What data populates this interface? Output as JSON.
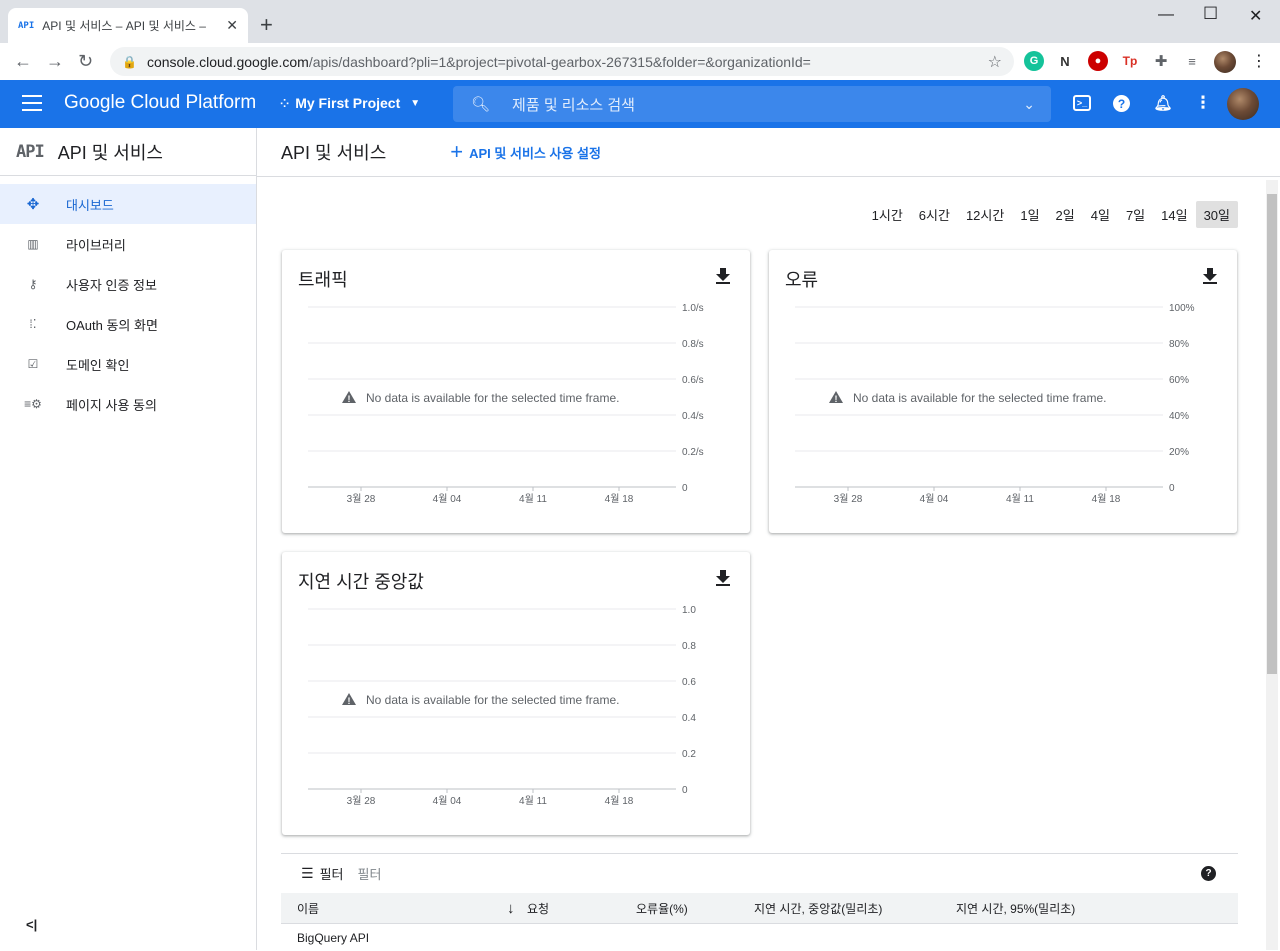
{
  "browser": {
    "tab_title": "API 및 서비스 – API 및 서비스 –",
    "tab_favicon": "API",
    "url_host": "console.cloud.google.com",
    "url_path": "/apis/dashboard?pli=1&project=pivotal-gearbox-267315&folder=&organizationId=",
    "extensions": [
      "grammarly-icon",
      "notion-icon",
      "adblock-icon",
      "tp-icon",
      "puzzle-icon",
      "playlist-icon"
    ]
  },
  "header": {
    "brand": "Google Cloud Platform",
    "project": "My First Project",
    "search_placeholder": "제품 및 리소스 검색",
    "accent": "#1a73e8"
  },
  "sidebar": {
    "logo": "API",
    "title": "API 및 서비스",
    "items": [
      {
        "label": "대시보드",
        "icon": "dashboard-icon",
        "active": true
      },
      {
        "label": "라이브러리",
        "icon": "library-icon"
      },
      {
        "label": "사용자 인증 정보",
        "icon": "key-icon"
      },
      {
        "label": "OAuth 동의 화면",
        "icon": "consent-icon"
      },
      {
        "label": "도메인 확인",
        "icon": "checkbox-icon"
      },
      {
        "label": "페이지 사용 동의",
        "icon": "settings-list-icon"
      }
    ]
  },
  "main": {
    "title": "API 및 서비스",
    "enable_label": "API 및 서비스 사용 설정",
    "time_ranges": [
      "1시간",
      "6시간",
      "12시간",
      "1일",
      "2일",
      "4일",
      "7일",
      "14일",
      "30일"
    ],
    "selected_range": "30일",
    "no_data": "No data is available for the selected time frame."
  },
  "chart_data": [
    {
      "type": "line",
      "title": "트래픽",
      "x_ticks": [
        "3월 28",
        "4월 04",
        "4월 11",
        "4월 18"
      ],
      "y_ticks": [
        "1.0/s",
        "0.8/s",
        "0.6/s",
        "0.4/s",
        "0.2/s",
        "0"
      ],
      "ylim": [
        0,
        1.0
      ],
      "series": [],
      "grid": true,
      "annotation": "No data is available for the selected time frame."
    },
    {
      "type": "line",
      "title": "오류",
      "x_ticks": [
        "3월 28",
        "4월 04",
        "4월 11",
        "4월 18"
      ],
      "y_ticks": [
        "100%",
        "80%",
        "60%",
        "40%",
        "20%",
        "0"
      ],
      "ylim": [
        0,
        100
      ],
      "series": [],
      "grid": true,
      "annotation": "No data is available for the selected time frame."
    },
    {
      "type": "line",
      "title": "지연 시간 중앙값",
      "x_ticks": [
        "3월 28",
        "4월 04",
        "4월 11",
        "4월 18"
      ],
      "y_ticks": [
        "1.0",
        "0.8",
        "0.6",
        "0.4",
        "0.2",
        "0"
      ],
      "ylim": [
        0,
        1.0
      ],
      "series": [],
      "grid": true,
      "annotation": "No data is available for the selected time frame."
    }
  ],
  "table": {
    "filter_label": "필터",
    "filter_placeholder": "필터",
    "columns": [
      "이름",
      "요청",
      "오류율(%)",
      "지연 시간, 중앙값(밀리초)",
      "지연 시간, 95%(밀리초)"
    ],
    "rows": [
      [
        "BigQuery API",
        "",
        "",
        "",
        ""
      ]
    ]
  }
}
